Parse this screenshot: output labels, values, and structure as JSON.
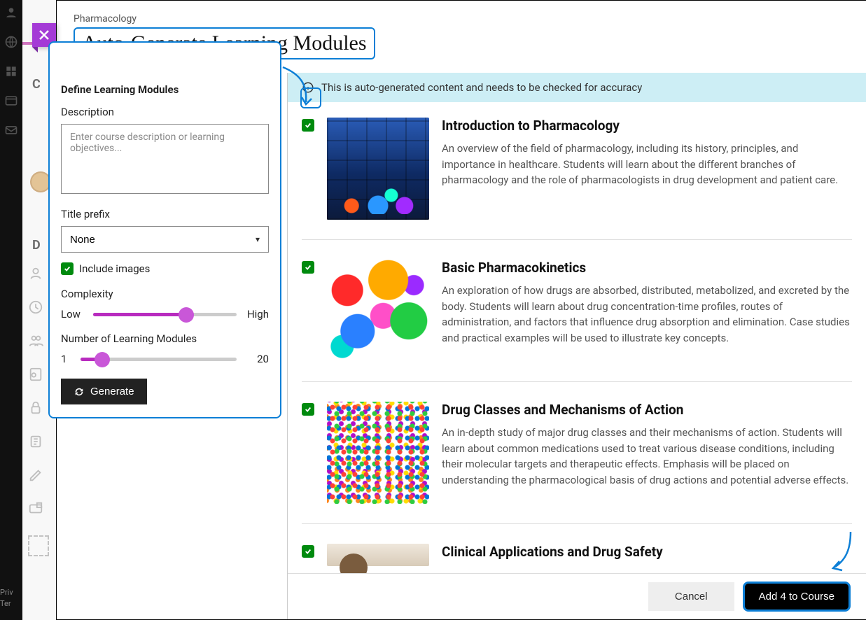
{
  "header": {
    "course_name": "Pharmacology",
    "title": "Auto-Generate Learning Modules"
  },
  "sidebar_text": {
    "co_tab": "Co",
    "c_label": "C",
    "d_label": "D",
    "priv": "Priv",
    "ter": "Ter"
  },
  "define": {
    "heading": "Define Learning Modules",
    "description_label": "Description",
    "description_placeholder": "Enter course description or learning objectives...",
    "title_prefix_label": "Title prefix",
    "title_prefix_value": "None",
    "include_images_label": "Include images",
    "include_images_checked": true,
    "complexity_label": "Complexity",
    "complexity_low": "Low",
    "complexity_high": "High",
    "complexity_percent": 65,
    "count_label": "Number of Learning Modules",
    "count_min": "1",
    "count_max": "20",
    "count_percent": 14,
    "generate_label": "Generate"
  },
  "banner": {
    "text": "This is auto-generated content and needs to be checked for accuracy"
  },
  "modules": [
    {
      "checked": true,
      "title": "Introduction to Pharmacology",
      "desc": "An overview of the field of pharmacology, including its history, principles, and importance in healthcare. Students will learn about the different branches of pharmacology and the role of pharmacologists in drug development and patient care.",
      "thumb": "lab"
    },
    {
      "checked": true,
      "title": "Basic Pharmacokinetics",
      "desc": "An exploration of how drugs are absorbed, distributed, metabolized, and excreted by the body. Students will learn about drug concentration-time profiles, routes of administration, and factors that influence drug absorption and elimination. Case studies and practical examples will be used to illustrate key concepts.",
      "thumb": "bubbles"
    },
    {
      "checked": true,
      "title": "Drug Classes and Mechanisms of Action",
      "desc": "An in-depth study of major drug classes and their mechanisms of action. Students will learn about common medications used to treat various disease conditions, including their molecular targets and therapeutic effects. Emphasis will be placed on understanding the pharmacological basis of drug actions and potential adverse effects.",
      "thumb": "confetti"
    },
    {
      "checked": true,
      "title": "Clinical Applications and Drug Safety",
      "desc": "",
      "thumb": "people"
    }
  ],
  "footer": {
    "cancel": "Cancel",
    "add": "Add 4 to Course"
  }
}
